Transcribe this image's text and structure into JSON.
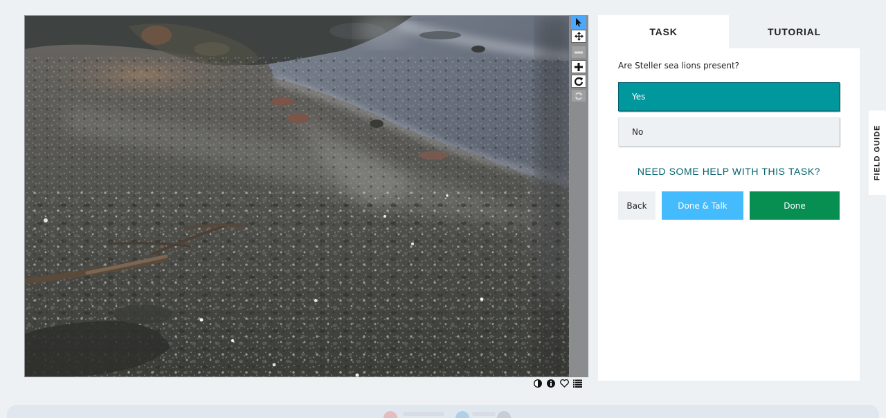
{
  "viewer": {
    "tools": [
      {
        "name": "annotate-tool",
        "glyph": "◤",
        "state": "active"
      },
      {
        "name": "move-tool",
        "glyph": "✛",
        "state": "normal"
      },
      {
        "name": "zoom-out-tool",
        "glyph": "−",
        "state": "disabled"
      },
      {
        "name": "zoom-in-tool",
        "glyph": "+",
        "state": "normal"
      },
      {
        "name": "rotate-tool",
        "glyph": "↻",
        "state": "normal"
      },
      {
        "name": "reset-tool",
        "glyph": "⟳",
        "state": "disabled"
      }
    ],
    "meta_icons": [
      "invert-icon",
      "info-icon",
      "favorite-icon",
      "collections-icon"
    ]
  },
  "task_panel": {
    "tabs": {
      "task": "TASK",
      "tutorial": "TUTORIAL"
    },
    "active_tab": "task",
    "question": "Are Steller sea lions present?",
    "answers": [
      {
        "label": "Yes",
        "selected": true
      },
      {
        "label": "No",
        "selected": false
      }
    ],
    "help_link": "NEED SOME HELP WITH THIS TASK?",
    "buttons": {
      "back": "Back",
      "done_talk": "Done & Talk",
      "done": "Done"
    }
  },
  "field_guide": {
    "label": "FIELD GUIDE"
  },
  "colors": {
    "accent_teal": "#00979d",
    "done_green": "#078f52",
    "talk_blue": "#43bbfd",
    "help_link": "#00616c",
    "active_tool": "#4aa8ff",
    "page_bg": "#eef1f4"
  }
}
